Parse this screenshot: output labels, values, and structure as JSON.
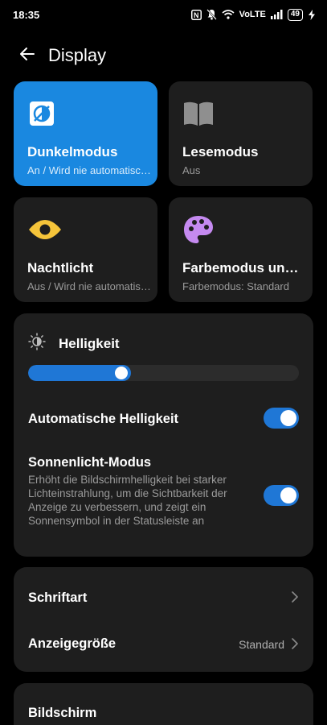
{
  "status_bar": {
    "time": "18:35",
    "network": "VoLTE",
    "battery": "49"
  },
  "header": {
    "title": "Display",
    "back_icon": "arrow-left-icon"
  },
  "tiles": [
    {
      "title": "Dunkelmodus",
      "subtitle": "An / Wird nie automatisch aktiviert",
      "icon": "dark-mode-icon",
      "active": true
    },
    {
      "title": "Lesemodus",
      "subtitle": "Aus",
      "icon": "book-icon",
      "active": false
    },
    {
      "title": "Nachtlicht",
      "subtitle": "Aus / Wird nie automatisch aktiviert",
      "icon": "eye-icon",
      "active": false
    },
    {
      "title": "Farbemodus und Farbtemperatur",
      "subtitle": "Farbemodus: Standard",
      "icon": "palette-icon",
      "active": false
    }
  ],
  "brightness": {
    "title": "Helligkeit",
    "level": 0.38,
    "auto_label": "Automatische Helligkeit",
    "auto_on": true,
    "sunlight_label": "Sonnenlicht-Modus",
    "sunlight_desc": "Erhöht die Bildschirmhelligkeit bei starker Lichteinstrahlung, um die Sichtbarkeit der Anzeige zu verbessern, und zeigt ein Sonnensymbol in der Statusleiste an",
    "sunlight_on": true
  },
  "font_card": {
    "font_label": "Schriftart",
    "size_label": "Anzeigegröße",
    "size_value": "Standard"
  },
  "screen_card": {
    "label": "Bildschirm"
  },
  "colors": {
    "accent": "#1a88e0",
    "card": "#1e1e1e",
    "background": "#000000",
    "eye_icon": "#f5c43a",
    "palette_icon": "#c58af0"
  }
}
